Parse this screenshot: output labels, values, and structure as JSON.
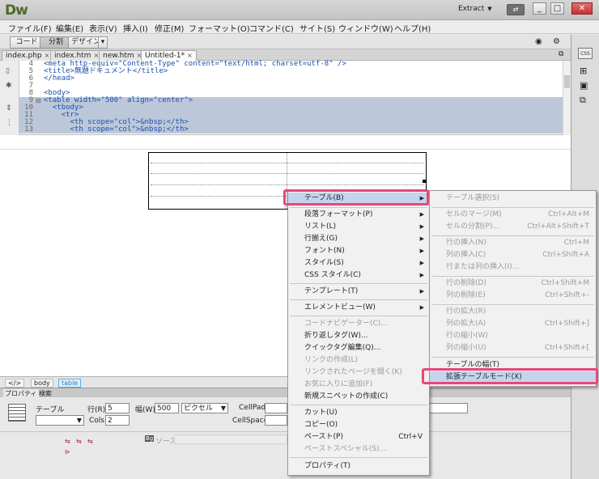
{
  "app": {
    "logo": "Dw",
    "workspace": "Extract",
    "window_buttons": {
      "minimize": "_",
      "restore": "□",
      "close": "✕"
    }
  },
  "menubar": {
    "items": [
      "ファイル(F)",
      "編集(E)",
      "表示(V)",
      "挿入(I)",
      "修正(M)",
      "フォーマット(O)",
      "コマンド(C)",
      "サイト(S)",
      "ウィンドウ(W)",
      "ヘルプ(H)"
    ]
  },
  "toolbar": {
    "code_label": "コード",
    "split_label": "分割",
    "design_label": "デザイン"
  },
  "tabs": [
    {
      "label": "index.php"
    },
    {
      "label": "index.htm"
    },
    {
      "label": "new.htm"
    },
    {
      "label": "Untitled-1*"
    }
  ],
  "code": {
    "lines": [
      {
        "num": "4",
        "text": "<meta http-equiv=\"Content-Type\" content=\"text/html; charset=utf-8\" />"
      },
      {
        "num": "5",
        "text": "<title>無題ドキュメント</title>"
      },
      {
        "num": "6",
        "text": "</head>"
      },
      {
        "num": "7",
        "text": ""
      },
      {
        "num": "8",
        "text": "<body>"
      },
      {
        "num": "9",
        "text": "<table width=\"500\" align=\"center\">"
      },
      {
        "num": "10",
        "text": "  <tbody>"
      },
      {
        "num": "11",
        "text": "    <tr>"
      },
      {
        "num": "12",
        "text": "      <th scope=\"col\">&nbsp;</th>"
      },
      {
        "num": "13",
        "text": "      <th scope=\"col\">&nbsp;</th>"
      }
    ]
  },
  "status": {
    "tags": [
      "body",
      "table"
    ],
    "tag_icon": "</>"
  },
  "properties": {
    "tabs": [
      "プロパティ",
      "検索"
    ],
    "table_label": "テーブル",
    "rows_label": "行(R)",
    "rows_value": "5",
    "cols_label": "Cols",
    "cols_value": "2",
    "width_label": "幅(W)",
    "width_value": "500",
    "width_unit": "ピクセル",
    "cellpad_label": "CellPad",
    "cellspace_label": "CellSpace",
    "source_label": "ソース"
  },
  "context_menu": {
    "items": [
      {
        "label": "テーブル(B)",
        "sub": "▶"
      },
      {
        "label": "段落フォーマット(P)",
        "sub": "▶"
      },
      {
        "label": "リスト(L)",
        "sub": "▶"
      },
      {
        "label": "行揃え(G)",
        "sub": "▶"
      },
      {
        "label": "フォント(N)",
        "sub": "▶"
      },
      {
        "label": "スタイル(S)",
        "sub": "▶"
      },
      {
        "label": "CSS スタイル(C)",
        "sub": "▶"
      },
      {
        "label": "テンプレート(T)",
        "sub": "▶"
      },
      {
        "label": "エレメントビュー(W)",
        "sub": "▶"
      },
      {
        "label": "コードナビゲーター(C)..."
      },
      {
        "label": "折り返しタグ(W)..."
      },
      {
        "label": "クイックタグ編集(Q)..."
      },
      {
        "label": "リンクの作成(L)"
      },
      {
        "label": "リンクされたページを開く(K)"
      },
      {
        "label": "お気に入りに追加(F)"
      },
      {
        "label": "新規スニペットの作成(C)"
      },
      {
        "label": "カット(U)"
      },
      {
        "label": "コピー(O)"
      },
      {
        "label": "ペースト(P)",
        "shortcut": "Ctrl+V"
      },
      {
        "label": "ペーストスペシャル(S)..."
      },
      {
        "label": "プロパティ(T)"
      }
    ]
  },
  "submenu": {
    "items": [
      {
        "label": "テーブル選択(S)"
      },
      {
        "label": "セルのマージ(M)",
        "shortcut": "Ctrl+Alt+M"
      },
      {
        "label": "セルの分割(P)...",
        "shortcut": "Ctrl+Alt+Shift+T"
      },
      {
        "label": "行の挿入(N)",
        "shortcut": "Ctrl+M"
      },
      {
        "label": "列の挿入(C)",
        "shortcut": "Ctrl+Shift+A"
      },
      {
        "label": "行または列の挿入(I)..."
      },
      {
        "label": "行の削除(D)",
        "shortcut": "Ctrl+Shift+M"
      },
      {
        "label": "列の削除(E)",
        "shortcut": "Ctrl+Shift+-"
      },
      {
        "label": "行の拡大(R)"
      },
      {
        "label": "列の拡大(A)",
        "shortcut": "Ctrl+Shift+]"
      },
      {
        "label": "行の縮小(W)"
      },
      {
        "label": "列の縮小(U)",
        "shortcut": "Ctrl+Shift+["
      },
      {
        "label": "テーブルの幅(T)"
      },
      {
        "label": "拡張テーブルモード(X)"
      }
    ]
  },
  "colors": {
    "highlight": "#e8467a",
    "menu_hover": "#c5d4ec",
    "selection": "#bcc8da"
  }
}
